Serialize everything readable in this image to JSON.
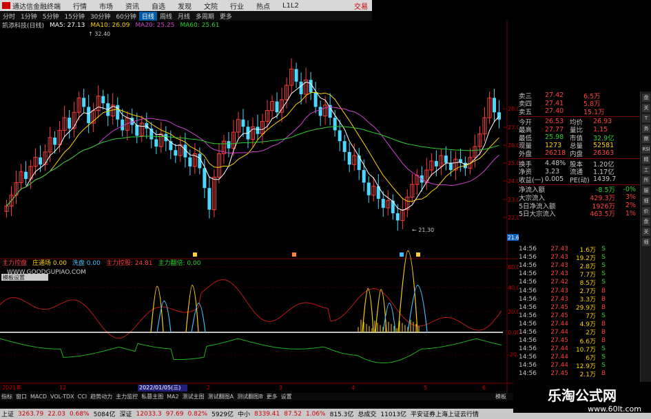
{
  "titlebar": {
    "app": "通达信金融终端",
    "menus": [
      "行情",
      "市场",
      "资讯",
      "自选",
      "发现",
      "文院",
      "行业",
      "热点",
      "L1L2"
    ],
    "trade": "交易"
  },
  "periods": [
    "分时",
    "1分钟",
    "5分钟",
    "15分钟",
    "30分钟",
    "60分钟",
    "日线",
    "周线",
    "月线",
    "多周期",
    "更多"
  ],
  "selected_period": "日线",
  "stock_label": "凯添科技(日线)",
  "ma": [
    {
      "label": "MA5: 27.13",
      "color": "#ffffff"
    },
    {
      "label": "MA10: 26.09",
      "color": "#ffd400"
    },
    {
      "label": "MA20: 25.25",
      "color": "#d040d0"
    },
    {
      "label": "MA60: 25.61",
      "color": "#30d030"
    }
  ],
  "price_axis": [
    "28.00",
    "27.00",
    "26.00",
    "25.00",
    "24.00",
    "23.00",
    "22.00"
  ],
  "high_label": "32.40",
  "low_label": "21.30",
  "current_price_tag": "21.68",
  "ind_header": [
    {
      "t": "主力控盘",
      "c": "#ff4040"
    },
    {
      "t": "庄通场 0.00",
      "c": "#ffd400"
    },
    {
      "t": "洗盘 0.00",
      "c": "#40c0ff"
    },
    {
      "t": "主力控股: 24.81",
      "c": "#ff4040"
    },
    {
      "t": "主力翻倍: 0.00",
      "c": "#30d030"
    }
  ],
  "site": "WWW.GOODGUPIAO.COM",
  "palette_btn": "模板设置",
  "ind_axis": [
    "60.00",
    "40.00",
    "20.00",
    "0.00",
    "-20.00"
  ],
  "date_axis": [
    "2021年",
    "12",
    "2022/01/05(三)",
    "2",
    "3",
    "4",
    "5",
    "6"
  ],
  "quote": [
    {
      "l": "卖三",
      "v": "27.42",
      "v2": "6.5万",
      "c": "#ff4040"
    },
    {
      "l": "卖四",
      "v": "27.41",
      "v2": "5.8万",
      "c": "#ff4040"
    },
    {
      "l": "卖五",
      "v": "27.40",
      "v2": "15.1万",
      "c": "#ff4040"
    },
    {
      "l": "今开",
      "v": "26.53",
      "l2": "均价",
      "v3": "26.93",
      "c": "#ff4040"
    },
    {
      "l": "最高",
      "v": "27.77",
      "l2": "量比",
      "v3": "1.15",
      "c": "#ff4040"
    },
    {
      "l": "最低",
      "v": "25.98",
      "l2": "市值",
      "v3": "32.9亿",
      "c": "#30d030"
    },
    {
      "l": "现量",
      "v": "1273",
      "l2": "总量",
      "v3": "52581",
      "c": "#ffd400"
    },
    {
      "l": "外盘",
      "v": "26218",
      "l2": "内盘",
      "v3": "26363",
      "c": "#ff4040"
    },
    {
      "l": "换手",
      "v": "4.48%",
      "l2": "股本",
      "v3": "1.20亿",
      "c": "#c8c8c8"
    },
    {
      "l": "净资",
      "v": "3.23",
      "l2": "流通",
      "v3": "1.17亿",
      "c": "#c8c8c8"
    },
    {
      "l": "收益(一)",
      "v": "0.005",
      "l2": "PE(动)",
      "v3": "1439.7",
      "c": "#c8c8c8"
    }
  ],
  "flows": [
    {
      "l": "净流入额",
      "v": "-8.5万",
      "p": "-0%",
      "c": "#30d030"
    },
    {
      "l": "大宗流入",
      "v": "429.3万",
      "p": "3%",
      "c": "#ff4040"
    },
    {
      "l": "5日净流入额",
      "v": "1926万",
      "p": "2%",
      "c": "#ff4040"
    },
    {
      "l": "5日大宗流入",
      "v": "463.5万",
      "p": "1%",
      "c": "#ff4040"
    }
  ],
  "ticks": [
    {
      "t": "14:56",
      "p": "27.43",
      "v": "1.6万",
      "d": "S"
    },
    {
      "t": "14:56",
      "p": "27.43",
      "v": "19.2万",
      "d": "S"
    },
    {
      "t": "14:56",
      "p": "27.43",
      "v": "2.8万",
      "d": "S"
    },
    {
      "t": "14:56",
      "p": "27.43",
      "v": "7.7万",
      "d": "S"
    },
    {
      "t": "14:56",
      "p": "27.42",
      "v": "8.5万",
      "d": "S"
    },
    {
      "t": "14:56",
      "p": "27.43",
      "v": "2.7万",
      "d": "B"
    },
    {
      "t": "14:56",
      "p": "27.43",
      "v": "3.3万",
      "d": "B"
    },
    {
      "t": "14:56",
      "p": "27.45",
      "v": "29.9万",
      "d": "B"
    },
    {
      "t": "14:56",
      "p": "27.45",
      "v": "7万",
      "d": "S"
    },
    {
      "t": "14:56",
      "p": "27.44",
      "v": "4.9万",
      "d": "B"
    },
    {
      "t": "14:56",
      "p": "27.44",
      "v": "2万",
      "d": "B"
    },
    {
      "t": "14:56",
      "p": "27.45",
      "v": "6.6万",
      "d": "B"
    },
    {
      "t": "14:56",
      "p": "27.44",
      "v": "10.7万",
      "d": "S"
    },
    {
      "t": "14:56",
      "p": "27.44",
      "v": "6万",
      "d": "S"
    },
    {
      "t": "14:56",
      "p": "27.44",
      "v": "12.9万",
      "d": "S"
    },
    {
      "t": "14:56",
      "p": "27.45",
      "v": "2.1万",
      "d": "B"
    }
  ],
  "right_icons": [
    "盘",
    "关",
    "T",
    "务",
    "鼎",
    "RSI",
    "精",
    "工",
    "所",
    "服",
    "细",
    "价",
    "盘",
    "关",
    "细"
  ],
  "bottom_tabs": [
    "指标",
    "窗口",
    "MACD",
    "VOL-TDX",
    "CCI",
    "趋势动力",
    "主力监控",
    "私募主图",
    "MA2",
    "测试主图",
    "测试翻图A",
    "测试翻图B",
    "更多",
    "设置"
  ],
  "bottom_right": "模板",
  "status": [
    {
      "t": "上证",
      "c": "#000"
    },
    {
      "t": "3263.79",
      "c": "#c00"
    },
    {
      "t": "22.03",
      "c": "#c00"
    },
    {
      "t": "0.68%",
      "c": "#c00"
    },
    {
      "t": "5084亿",
      "c": "#000"
    },
    {
      "t": "深证",
      "c": "#000"
    },
    {
      "t": "12033.3",
      "c": "#c00"
    },
    {
      "t": "97.69",
      "c": "#c00"
    },
    {
      "t": "0.82%",
      "c": "#c00"
    },
    {
      "t": "5929亿",
      "c": "#000"
    },
    {
      "t": "中小",
      "c": "#000"
    },
    {
      "t": "8339.41",
      "c": "#c00"
    },
    {
      "t": "87.52",
      "c": "#c00"
    },
    {
      "t": "1.06%",
      "c": "#c00"
    },
    {
      "t": "815.3亿",
      "c": "#000"
    },
    {
      "t": "总成交",
      "c": "#000"
    },
    {
      "t": "11013亿",
      "c": "#000"
    },
    {
      "t": "平安证券上海上证云行情",
      "c": "#000"
    }
  ],
  "watermark": {
    "line1": "乐淘公式网",
    "line2": "www.60lt.com"
  }
}
